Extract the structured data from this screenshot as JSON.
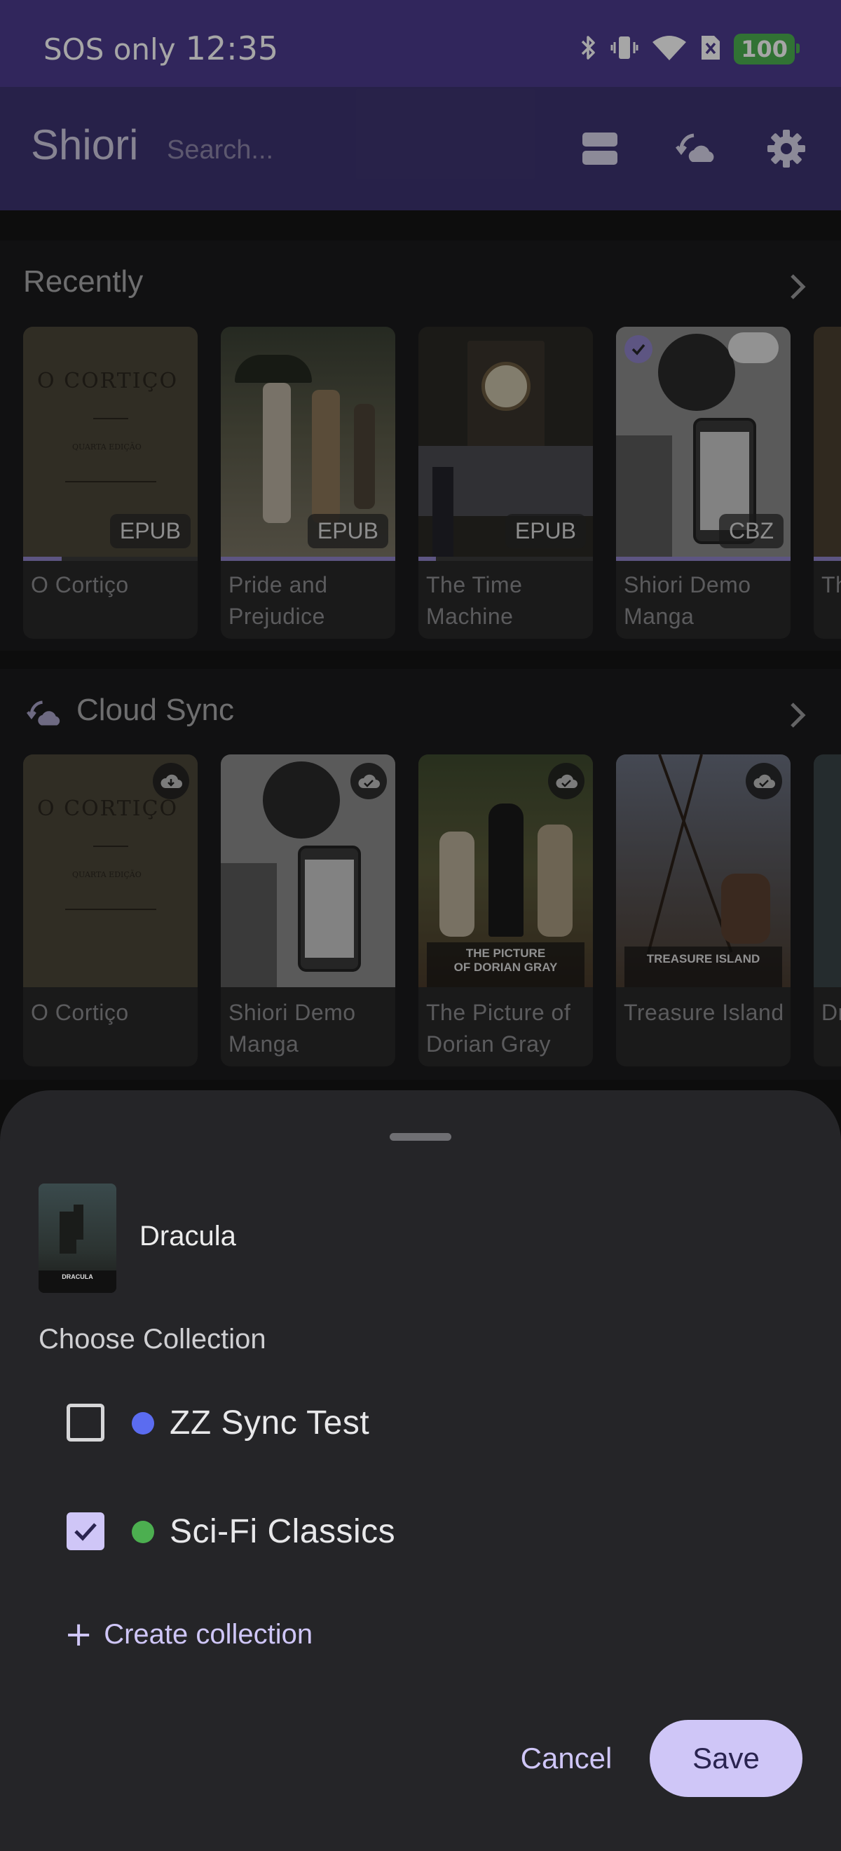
{
  "status_bar": {
    "carrier": "SOS only",
    "time": "12:35",
    "battery": "100",
    "icons": [
      "bluetooth-icon",
      "vibrate-icon",
      "wifi-icon",
      "no-sim-icon",
      "battery-icon"
    ]
  },
  "app_bar": {
    "title": "Shiori",
    "search_placeholder": "Search...",
    "icons": [
      "view-toggle-icon",
      "cloud-sync-icon",
      "settings-icon"
    ]
  },
  "recent": {
    "title": "Recently",
    "books": [
      {
        "title": "O Cortiço",
        "format": "EPUB",
        "progress": 0.22,
        "selected": false
      },
      {
        "title": "Pride and Prejudice",
        "format": "EPUB",
        "progress": 1.0,
        "selected": false
      },
      {
        "title": "The Time Machine",
        "format": "EPUB",
        "progress": 0.1,
        "selected": false
      },
      {
        "title": "Shiori Demo Manga",
        "format": "CBZ",
        "progress": 1.0,
        "selected": true
      },
      {
        "title": "The Dracula",
        "format": "",
        "progress": 1.0,
        "selected": false
      }
    ]
  },
  "cloud": {
    "title": "Cloud Sync",
    "books": [
      {
        "title": "O Cortiço",
        "cloud_state": "download"
      },
      {
        "title": "Shiori Demo Manga",
        "cloud_state": "synced"
      },
      {
        "title": "The Picture of Dorian Gray",
        "cloud_state": "synced"
      },
      {
        "title": "Treasure Island",
        "cloud_state": "synced"
      },
      {
        "title": "Dracula",
        "cloud_state": "synced"
      }
    ]
  },
  "sheet": {
    "book_title": "Dracula",
    "cover_title": "DRACULA",
    "choose_label": "Choose Collection",
    "collections": [
      {
        "name": "ZZ Sync Test",
        "color": "#5b6cf0",
        "checked": false
      },
      {
        "name": "Sci-Fi Classics",
        "color": "#4caf50",
        "checked": true
      }
    ],
    "create_plus": "+",
    "create_label": "Create collection",
    "cancel_label": "Cancel",
    "save_label": "Save"
  },
  "colors": {
    "status_bar": "#4c3b8e",
    "app_bar": "#3d3470",
    "accent": "#cfc6f7",
    "sheet": "#252528"
  }
}
